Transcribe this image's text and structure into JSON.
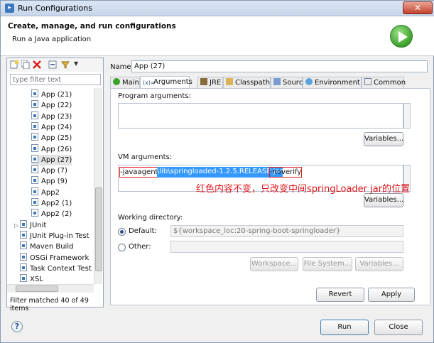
{
  "window": {
    "title": "Run Configurations",
    "close_label": "✕"
  },
  "header": {
    "title": "Create, manage, and run configurations",
    "subtitle": "Run a Java application"
  },
  "left": {
    "filter_placeholder": "type filter text",
    "tree": [
      {
        "label": "App (21)",
        "icon": "java-app-icon",
        "selected": false
      },
      {
        "label": "App (22)",
        "icon": "java-app-icon",
        "selected": false
      },
      {
        "label": "App (23)",
        "icon": "java-app-icon",
        "selected": false
      },
      {
        "label": "App (24)",
        "icon": "java-app-icon",
        "selected": false
      },
      {
        "label": "App (25)",
        "icon": "java-app-icon",
        "selected": false
      },
      {
        "label": "App (26)",
        "icon": "java-app-icon",
        "selected": false
      },
      {
        "label": "App (27)",
        "icon": "java-app-icon",
        "selected": true
      },
      {
        "label": "App (7)",
        "icon": "java-app-icon",
        "selected": false
      },
      {
        "label": "App (9)",
        "icon": "java-app-icon",
        "selected": false
      },
      {
        "label": "App2",
        "icon": "java-app-icon",
        "selected": false
      },
      {
        "label": "App2 (1)",
        "icon": "java-app-icon",
        "selected": false
      },
      {
        "label": "App2 (2)",
        "icon": "java-app-icon",
        "selected": false
      },
      {
        "label": "JUnit",
        "icon": "junit-icon",
        "selected": false
      },
      {
        "label": "JUnit Plug-in Test",
        "icon": "junit-plugin-icon",
        "selected": false
      },
      {
        "label": "Maven Build",
        "icon": "maven-icon",
        "selected": false
      },
      {
        "label": "OSGi Framework",
        "icon": "osgi-icon",
        "selected": false
      },
      {
        "label": "Task Context Test",
        "icon": "task-context-icon",
        "selected": false
      },
      {
        "label": "XSL",
        "icon": "xsl-icon",
        "selected": false
      }
    ],
    "status": "Filter matched 40 of 49 items"
  },
  "main": {
    "name_label": "Name:",
    "name_value": "App (27)",
    "tabs": [
      "Main",
      "Arguments",
      "JRE",
      "Classpath",
      "Source",
      "Environment",
      "Common"
    ],
    "active_tab": "Arguments",
    "program_args_label": "Program arguments:",
    "variables_label": "Variables...",
    "vm_args_label": "VM arguments:",
    "vm_args": {
      "part1": "-javaagent:",
      "part2": "\\lib\\springloaded-1.2.5.RELEASE.jar",
      "part3": " -noverify"
    },
    "annotation": "红色内容不变，只改变中间springLoader jar的位置",
    "working_dir_label": "Working directory:",
    "default_label": "Default:",
    "default_value": "${workspace_loc:20-spring-boot-springloader}",
    "other_label": "Other:",
    "workspace_btn": "Workspace...",
    "filesystem_btn": "File System...",
    "revert_label": "Revert",
    "apply_label": "Apply"
  },
  "footer": {
    "help": "?",
    "run_label": "Run",
    "close_label": "Close"
  }
}
